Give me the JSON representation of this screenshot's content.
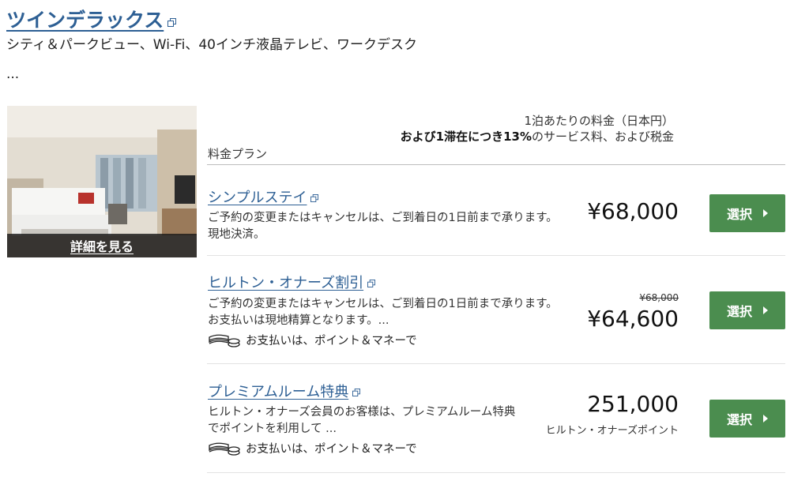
{
  "room": {
    "title": "ツインデラックス",
    "description": "シティ＆パークビュー、Wi-Fi、40インチ液晶テレビ、ワークデスク",
    "more": "..."
  },
  "photo": {
    "caption": "詳細を見る"
  },
  "table_header": {
    "plan_label": "料金プラン",
    "rate_line1": "1泊あたりの料金（日本円）",
    "rate_bold": "および1滞在につき13%",
    "rate_rest": "のサービス料、および税金"
  },
  "plans": [
    {
      "title": "シンプルステイ",
      "text": "ご予約の変更またはキャンセルは、ご到着日の1日前まで承ります。現地決済。",
      "price": "¥68,000",
      "button": "選択"
    },
    {
      "title": "ヒルトン・オナーズ割引",
      "text": "ご予約の変更またはキャンセルは、ご到着日の1日前まで承ります。お支払いは現地精算となります。...",
      "pay_note": "お支払いは、ポイント＆マネーで",
      "old_price": "¥68,000",
      "price": "¥64,600",
      "button": "選択"
    },
    {
      "title": "プレミアムルーム特典",
      "text": "ヒルトン・オナーズ会員のお客様は、プレミアムルーム特典でポイントを利用して ...",
      "pay_note": "お支払いは、ポイント＆マネーで",
      "price": "251,000",
      "price_unit": "ヒルトン・オナーズポイント",
      "button": "選択"
    }
  ],
  "colors": {
    "link": "#2d5f94",
    "button": "#4b8d4f"
  },
  "icons": [
    "external-link-icon",
    "coins-cash-icon",
    "caret-right-icon"
  ]
}
